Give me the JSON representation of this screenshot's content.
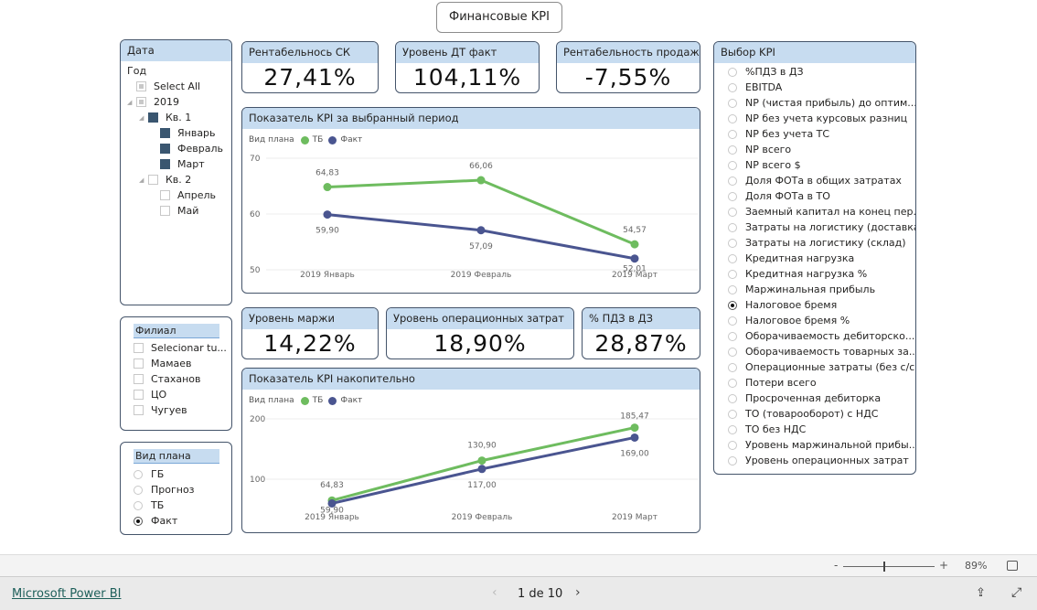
{
  "title": "Финансовые KPI",
  "date_slicer": {
    "header": "Дата",
    "level": "Год",
    "items": [
      {
        "label": "Select All",
        "indent": 0,
        "state": "part",
        "tri": false
      },
      {
        "label": "2019",
        "indent": 0,
        "state": "part",
        "tri": true
      },
      {
        "label": "Кв. 1",
        "indent": 1,
        "state": "on",
        "tri": true
      },
      {
        "label": "Январь",
        "indent": 2,
        "state": "on",
        "tri": false
      },
      {
        "label": "Февраль",
        "indent": 2,
        "state": "on",
        "tri": false
      },
      {
        "label": "Март",
        "indent": 2,
        "state": "on",
        "tri": false
      },
      {
        "label": "Кв. 2",
        "indent": 1,
        "state": "off",
        "tri": true
      },
      {
        "label": "Апрель",
        "indent": 2,
        "state": "off",
        "tri": false
      },
      {
        "label": "Май",
        "indent": 2,
        "state": "off",
        "tri": false
      }
    ]
  },
  "filial_slicer": {
    "header": "Филиал",
    "items": [
      "Selecionar tu...",
      "Мамаев",
      "Стаханов",
      "ЦО",
      "Чугуев"
    ]
  },
  "plan_slicer": {
    "header": "Вид плана",
    "items": [
      "ГБ",
      "Прогноз",
      "ТБ",
      "Факт"
    ],
    "selected": "Факт"
  },
  "cards": [
    {
      "label": "Рентабельнось СК",
      "value": "27,41%"
    },
    {
      "label": "Уровень ДТ факт",
      "value": "104,11%"
    },
    {
      "label": "Рентабельность продаж",
      "value": "-7,55%"
    },
    {
      "label": "Уровень маржи",
      "value": "14,22%"
    },
    {
      "label": "Уровень операционных затрат",
      "value": "18,90%"
    },
    {
      "label": "% ПДЗ в ДЗ",
      "value": "28,87%"
    }
  ],
  "kpi_slicer": {
    "header": "Выбор KPI",
    "selected": "Налоговое бремя",
    "items": [
      "%ПДЗ в ДЗ",
      "EBITDA",
      "NP (чистая прибыль) до оптим...",
      "NP без учета курсовых разниц",
      "NP без учета ТС",
      "NP всего",
      "NP всего $",
      "Доля ФОТа в общих затратах",
      "Доля ФОТа в ТО",
      "Заемный капитал на конец пер...",
      "Затраты на логистику (доставка)",
      "Затраты на логистику (склад)",
      "Кредитная нагрузка",
      "Кредитная нагрузка %",
      "Маржинальная прибыль",
      "Налоговое бремя",
      "Налоговое бремя %",
      "Оборачиваемость дебиторско...",
      "Оборачиваемость товарных за...",
      "Операционные затраты (без с/с)",
      "Потери всего",
      "Просроченная дебиторка",
      "ТО (товарооборот) с НДС",
      "ТО без НДС",
      "Уровень маржинальной прибы...",
      "Уровень операционных затрат"
    ]
  },
  "chart_data": [
    {
      "type": "line",
      "title": "Показатель KPI за выбранный период",
      "legend_title": "Вид плана",
      "legend_position": "top-left",
      "grid": true,
      "categories": [
        "2019 Январь",
        "2019 Февраль",
        "2019 Март"
      ],
      "ylim": [
        50,
        70
      ],
      "yticks": [
        "70",
        "60",
        "50"
      ],
      "series": [
        {
          "name": "ТБ",
          "color": "#6ebc5f",
          "values": [
            64.83,
            66.06,
            54.57
          ],
          "labels": [
            "64,83",
            "66,06",
            "54,57"
          ]
        },
        {
          "name": "Факт",
          "color": "#4a5590",
          "values": [
            59.9,
            57.09,
            52.01
          ],
          "labels": [
            "59,90",
            "57,09",
            "52,01"
          ]
        }
      ]
    },
    {
      "type": "line",
      "title": "Показатель KPI накопительно",
      "legend_title": "Вид плана",
      "legend_position": "top-left",
      "grid": true,
      "categories": [
        "2019 Январь",
        "2019 Февраль",
        "2019 Март"
      ],
      "ylim": [
        100,
        200
      ],
      "yticks": [
        "200",
        "100"
      ],
      "series": [
        {
          "name": "ТБ",
          "color": "#6ebc5f",
          "values": [
            64.83,
            130.9,
            185.47
          ],
          "labels": [
            "64,83",
            "130,90",
            "185,47"
          ]
        },
        {
          "name": "Факт",
          "color": "#4a5590",
          "values": [
            59.9,
            117.0,
            169.0
          ],
          "labels": [
            "59,90",
            "117,00",
            "169,00"
          ]
        }
      ]
    }
  ],
  "footer": {
    "brand": "Microsoft Power BI",
    "page": "1 de 10",
    "zoom": "89%",
    "zoom_level": 0.45,
    "minus": "-",
    "plus": "+"
  }
}
